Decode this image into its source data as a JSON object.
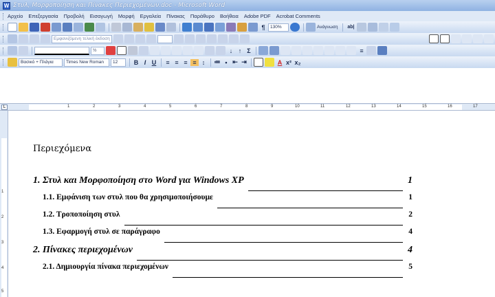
{
  "window": {
    "title": "Στυλ, Μορφοποίηση και Πίνακες Περιεχομένων.doc - Microsoft Word"
  },
  "menu": [
    "Αρχείο",
    "Επεξεργασία",
    "Προβολή",
    "Εισαγωγή",
    "Μορφή",
    "Εργαλεία",
    "Πίνακας",
    "Παράθυρο",
    "Βοήθεια",
    "Adobe PDF",
    "Acrobat Comments"
  ],
  "toolbar_standard": {
    "zoom": "130%",
    "reading": "Ανάγνωση"
  },
  "toolbar_formatting": {
    "style": "Βασικό + Πλάγια",
    "font": "Times New Roman",
    "size": "12",
    "bold": "B",
    "italic": "I",
    "underline": "U"
  },
  "toolbar_drawing": {
    "line_width": "½"
  },
  "toolbar_review": {
    "display": "Εμφανιζόμενη τελική έκδοση"
  },
  "ruler": {
    "h": [
      "1",
      "2",
      "3",
      "4",
      "5",
      "6",
      "7",
      "8",
      "9",
      "10",
      "11",
      "12",
      "13",
      "14",
      "15",
      "16",
      "17"
    ],
    "v": [
      "1",
      "2",
      "3",
      "4",
      "5"
    ]
  },
  "document": {
    "heading": "Περιεχόμενα",
    "toc": [
      {
        "level": 1,
        "label": "1. Στυλ και Μορφοποίηση στο Word για Windows XP",
        "page": "1"
      },
      {
        "level": 2,
        "label": "1.1. Εμφάνιση των στυλ που θα χρησιμοποιήσουμε",
        "page": "1"
      },
      {
        "level": 2,
        "label": "1.2. Τροποποίηση στυλ",
        "page": "2"
      },
      {
        "level": 2,
        "label": "1.3. Εφαρμογή στυλ σε παράγραφο",
        "page": "4"
      },
      {
        "level": 1,
        "label": "2. Πίνακες περιεχομένων",
        "page": "4"
      },
      {
        "level": 2,
        "label": "2.1. Δημιουργία πίνακα περιεχομένων",
        "page": "5"
      }
    ]
  }
}
